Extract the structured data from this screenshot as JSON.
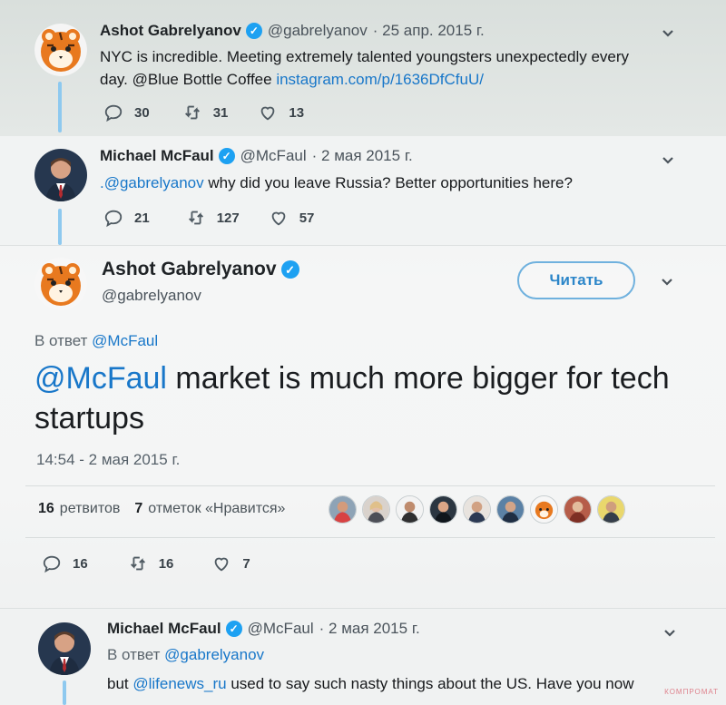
{
  "tweet1": {
    "name": "Ashot Gabrelyanov",
    "handle": "@gabrelyanov",
    "date": "· 25 апр. 2015 г.",
    "text_a": "NYC is incredible. Meeting extremely talented youngsters unexpectedly every",
    "text_b": "day. @Blue Bottle Coffee",
    "link": "instagram.com/p/1636DfCfuU/",
    "reply_count": "30",
    "retweet_count": "31",
    "like_count": "13"
  },
  "tweet2": {
    "name": "Michael McFaul",
    "handle": "@McFaul",
    "date": "· 2 мая 2015 г.",
    "mention": ".@gabrelyanov",
    "text": " why did you leave Russia? Better opportunities here?",
    "reply_count": "21",
    "retweet_count": "127",
    "like_count": "57"
  },
  "main_tweet": {
    "name": "Ashot Gabrelyanov",
    "handle": "@gabrelyanov",
    "follow_label": "Читать",
    "reply_prefix": "В ответ ",
    "reply_mention": "@McFaul",
    "mention": "@McFaul",
    "text": " market is much more bigger for tech startups",
    "timestamp": "14:54 - 2 мая 2015 г.",
    "retweets_count": "16",
    "retweets_label": "ретвитов",
    "likes_count": "7",
    "likes_label": "отметок «Нравится»",
    "reply_count": "16",
    "retweet_count": "16",
    "like_count": "7"
  },
  "tweet4": {
    "name": "Michael McFaul",
    "handle": "@McFaul",
    "date": "· 2 мая 2015 г.",
    "reply_prefix": "В ответ ",
    "reply_mention": "@gabrelyanov",
    "text_prefix": "but ",
    "text_mention": "@lifenews_ru",
    "text_suffix": " used to say such nasty things about the US. Have you now"
  },
  "watermark": "КОМПРОМАТ",
  "colors": {
    "link": "#1877c9",
    "verified": "#1da1f2",
    "thread_line": "#8ec9ef",
    "button_border": "#6fb1de"
  },
  "icons": [
    "reply-icon",
    "retweet-icon",
    "like-icon",
    "chevron-down-icon",
    "verified-badge-icon"
  ]
}
